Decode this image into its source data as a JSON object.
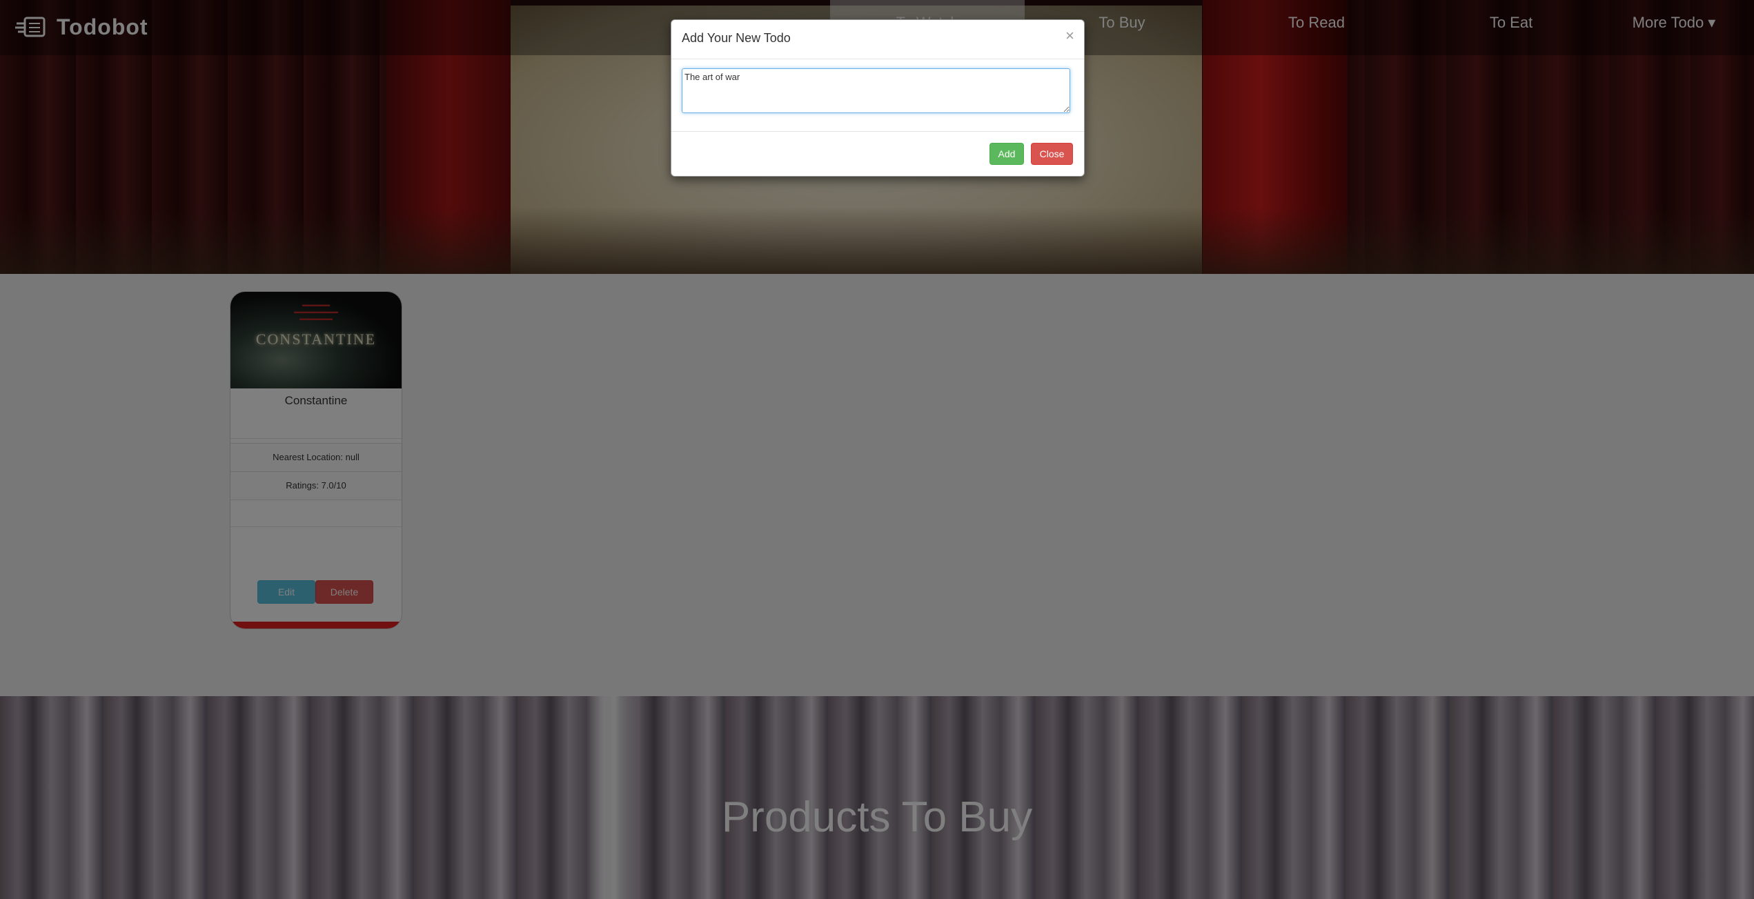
{
  "navbar": {
    "brand": "Todobot",
    "items": [
      {
        "label": "To Watch"
      },
      {
        "label": "To Buy"
      },
      {
        "label": "To Read"
      },
      {
        "label": "To Eat"
      },
      {
        "label": "More Todo ▾"
      }
    ]
  },
  "card": {
    "poster_title": "CONSTANTINE",
    "title": "Constantine",
    "location": "Nearest Location: null",
    "ratings": "Ratings: 7.0/10",
    "edit_label": "Edit",
    "delete_label": "Delete"
  },
  "section": {
    "heading": "Products To Buy"
  },
  "modal": {
    "title": "Add Your New Todo",
    "close_symbol": "×",
    "textarea_value": "The art of war",
    "add_label": "Add",
    "close_label": "Close"
  },
  "colors": {
    "add": "#5cb85c",
    "close": "#d9534f",
    "edit": "#5bc0de"
  }
}
